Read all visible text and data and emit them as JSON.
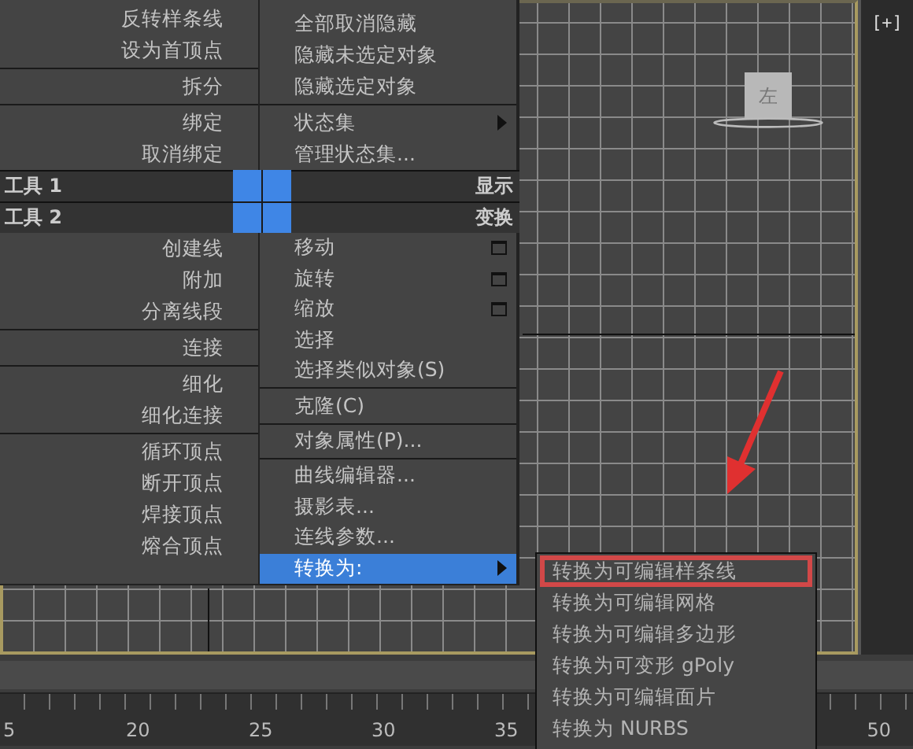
{
  "viewport": {
    "side_label": "[+]",
    "viewcube_label": "左"
  },
  "quad_menu": {
    "top_left": {
      "groups": [
        [
          {
            "label": "反转样条线",
            "kind": "plain",
            "selected": false
          },
          {
            "label": "设为首顶点",
            "kind": "plain",
            "selected": false
          }
        ],
        [
          {
            "label": "拆分",
            "kind": "plain",
            "selected": false
          }
        ],
        [
          {
            "label": "绑定",
            "kind": "plain",
            "selected": false
          },
          {
            "label": "取消绑定",
            "kind": "plain",
            "selected": false
          }
        ]
      ]
    },
    "top_right": {
      "groups": [
        [
          {
            "label": "全部取消隐藏",
            "kind": "plain",
            "selected": false
          },
          {
            "label": "隐藏未选定对象",
            "kind": "plain",
            "selected": false
          },
          {
            "label": "隐藏选定对象",
            "kind": "plain",
            "selected": false
          }
        ],
        [
          {
            "label": "状态集",
            "kind": "submenu",
            "selected": false
          },
          {
            "label": "管理状态集...",
            "kind": "plain",
            "selected": false
          }
        ]
      ]
    },
    "headers": {
      "left": [
        "工具 1",
        "工具 2"
      ],
      "right": [
        "显示",
        "变换"
      ]
    },
    "bottom_left": {
      "groups": [
        [
          {
            "label": "创建线",
            "kind": "plain",
            "selected": false
          },
          {
            "label": "附加",
            "kind": "plain",
            "selected": false
          },
          {
            "label": "分离线段",
            "kind": "plain",
            "selected": false
          }
        ],
        [
          {
            "label": "连接",
            "kind": "plain",
            "selected": false
          }
        ],
        [
          {
            "label": "细化",
            "kind": "plain",
            "selected": false
          },
          {
            "label": "细化连接",
            "kind": "plain",
            "selected": false
          }
        ],
        [
          {
            "label": "循环顶点",
            "kind": "plain",
            "selected": false
          },
          {
            "label": "断开顶点",
            "kind": "plain",
            "selected": false
          },
          {
            "label": "焊接顶点",
            "kind": "plain",
            "selected": false
          },
          {
            "label": "熔合顶点",
            "kind": "plain",
            "selected": false
          }
        ]
      ]
    },
    "bottom_right": {
      "groups": [
        [
          {
            "label": "移动",
            "kind": "option",
            "selected": false
          },
          {
            "label": "旋转",
            "kind": "option",
            "selected": false
          },
          {
            "label": "缩放",
            "kind": "option",
            "selected": false
          },
          {
            "label": "选择",
            "kind": "plain",
            "selected": false
          },
          {
            "label": "选择类似对象(S)",
            "kind": "plain",
            "selected": false
          }
        ],
        [
          {
            "label": "克隆(C)",
            "kind": "plain",
            "selected": false
          }
        ],
        [
          {
            "label": "对象属性(P)...",
            "kind": "plain",
            "selected": false
          }
        ],
        [
          {
            "label": "曲线编辑器...",
            "kind": "plain",
            "selected": false
          },
          {
            "label": "摄影表...",
            "kind": "plain",
            "selected": false
          },
          {
            "label": "连线参数...",
            "kind": "plain",
            "selected": false
          },
          {
            "label": "转换为:",
            "kind": "submenu",
            "selected": true
          }
        ]
      ]
    }
  },
  "submenu": {
    "items": [
      {
        "label": "转换为可编辑样条线",
        "annotated": true
      },
      {
        "label": "转换为可编辑网格",
        "annotated": false
      },
      {
        "label": "转换为可编辑多边形",
        "annotated": false
      },
      {
        "label": "转换为可变形 gPoly",
        "annotated": false
      },
      {
        "label": "转换为可编辑面片",
        "annotated": false
      },
      {
        "label": "转换为 NURBS",
        "annotated": false
      }
    ]
  },
  "timeline": {
    "ruler_labels": [
      "5",
      "20",
      "25",
      "30",
      "35",
      "50"
    ]
  }
}
